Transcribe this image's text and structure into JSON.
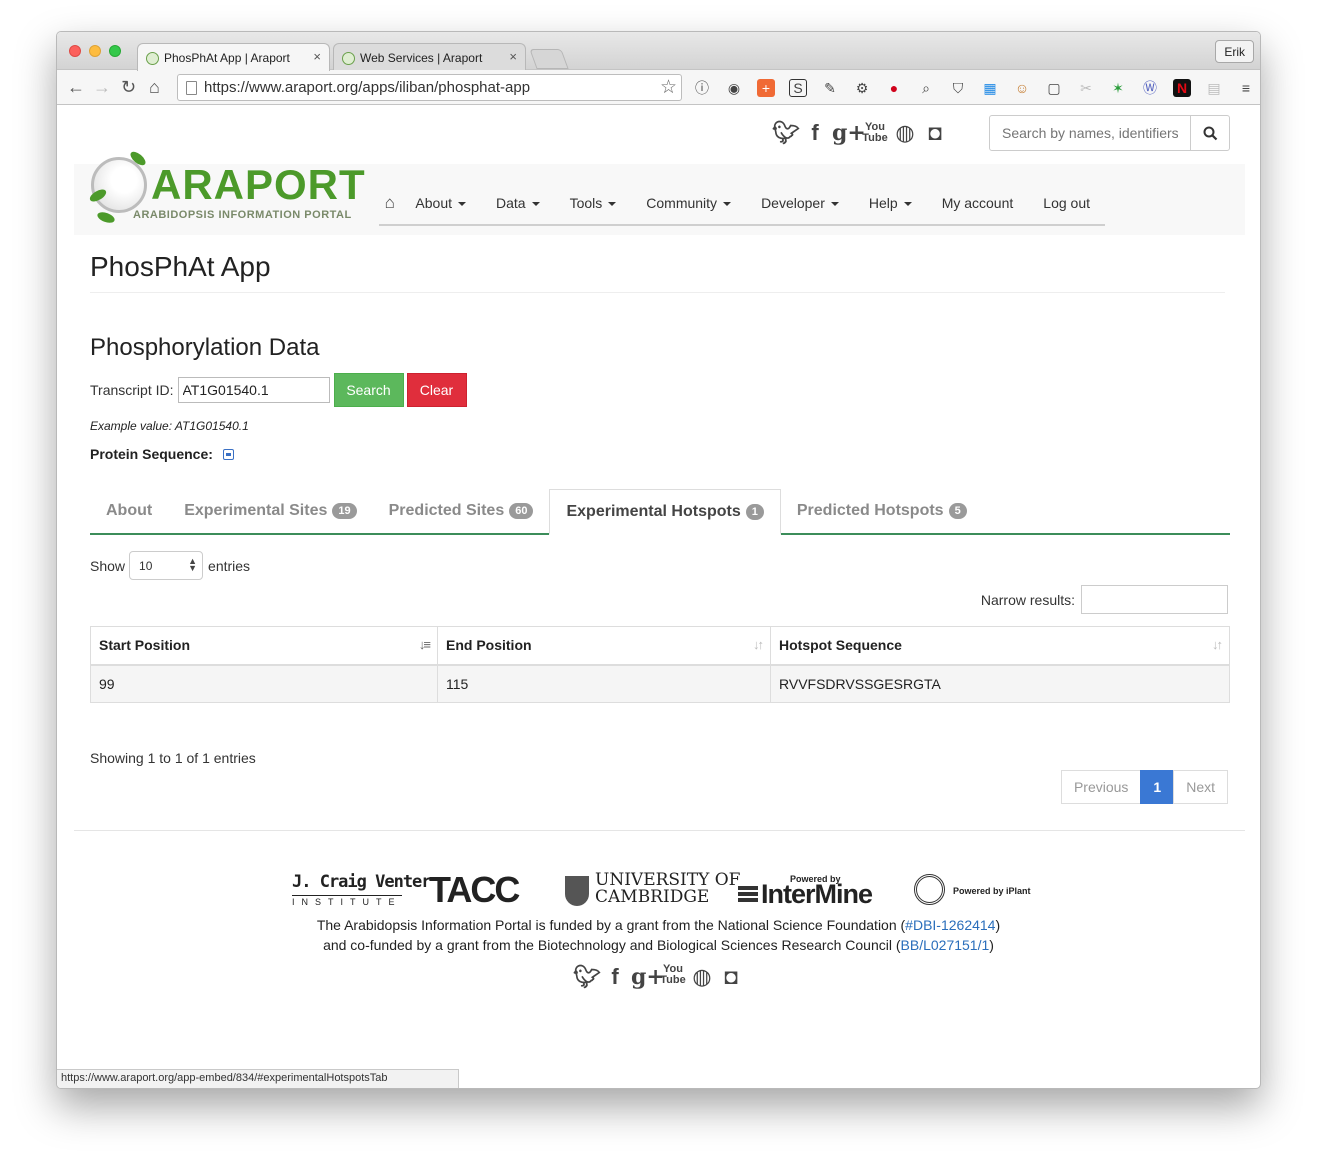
{
  "browser": {
    "tabs": [
      {
        "title": "PhosPhAt App | Araport",
        "active": true
      },
      {
        "title": "Web Services | Araport",
        "active": false
      }
    ],
    "profile": "Erik",
    "url": "https://www.araport.org/apps/iliban/phosphat-app",
    "status_url": "https://www.araport.org/app-embed/834/#experimentalHotspotsTab"
  },
  "site": {
    "search_placeholder": "Search by names, identifiers",
    "logo_text": "ARAPORT",
    "logo_sub": "ARABIDOPSIS INFORMATION PORTAL",
    "nav": [
      {
        "label": "About",
        "dropdown": true
      },
      {
        "label": "Data",
        "dropdown": true
      },
      {
        "label": "Tools",
        "dropdown": true
      },
      {
        "label": "Community",
        "dropdown": true
      },
      {
        "label": "Developer",
        "dropdown": true
      },
      {
        "label": "Help",
        "dropdown": true
      },
      {
        "label": "My account",
        "dropdown": false
      },
      {
        "label": "Log out",
        "dropdown": false
      }
    ]
  },
  "app": {
    "title": "PhosPhAt App",
    "section_title": "Phosphorylation Data",
    "transcript_label": "Transcript ID:",
    "transcript_value": "AT1G01540.1",
    "search_label": "Search",
    "clear_label": "Clear",
    "example": "Example value: AT1G01540.1",
    "protein_label": "Protein Sequence:",
    "tabs": [
      {
        "label": "About",
        "badge": ""
      },
      {
        "label": "Experimental Sites",
        "badge": "19"
      },
      {
        "label": "Predicted Sites",
        "badge": "60"
      },
      {
        "label": "Experimental Hotspots",
        "badge": "1"
      },
      {
        "label": "Predicted Hotspots",
        "badge": "5"
      }
    ],
    "active_tab": 3,
    "show_label": "Show",
    "entries_value": "10",
    "entries_label": "entries",
    "narrow_label": "Narrow results:",
    "table": {
      "columns": [
        "Start Position",
        "End Position",
        "Hotspot Sequence"
      ],
      "rows": [
        [
          "99",
          "115",
          "RVVFSDRVSSGESRGTA"
        ]
      ]
    },
    "showing": "Showing 1 to 1 of 1 entries",
    "pager": {
      "prev": "Previous",
      "current": "1",
      "next": "Next"
    }
  },
  "footer": {
    "sponsors": [
      "J. Craig Venter",
      "INSTITUTE",
      "TACC",
      "UNIVERSITY OF",
      "CAMBRIDGE",
      "Powered by",
      "InterMine",
      "Powered by iPlant"
    ],
    "line1_text": "The Arabidopsis Information Portal is funded by a grant from the National Science Foundation (",
    "line1_link": "#DBI-1262414",
    "line1_end": ")",
    "line2_text": "and co-funded by a grant from the Biotechnology and Biological Sciences Research Council (",
    "line2_link": "BB/L027151/1",
    "line2_end": ")"
  },
  "social": [
    "twitter-icon",
    "facebook-icon",
    "google-plus-icon",
    "youtube-icon",
    "github-icon",
    "slideshare-icon"
  ],
  "colors": {
    "brand_green": "#4c9a2a",
    "search_btn": "#5cb85c",
    "clear_btn": "#e02e3c",
    "link": "#2a6ebb",
    "pager_active": "#3a78d4",
    "tab_rule": "#3c8d5a"
  }
}
